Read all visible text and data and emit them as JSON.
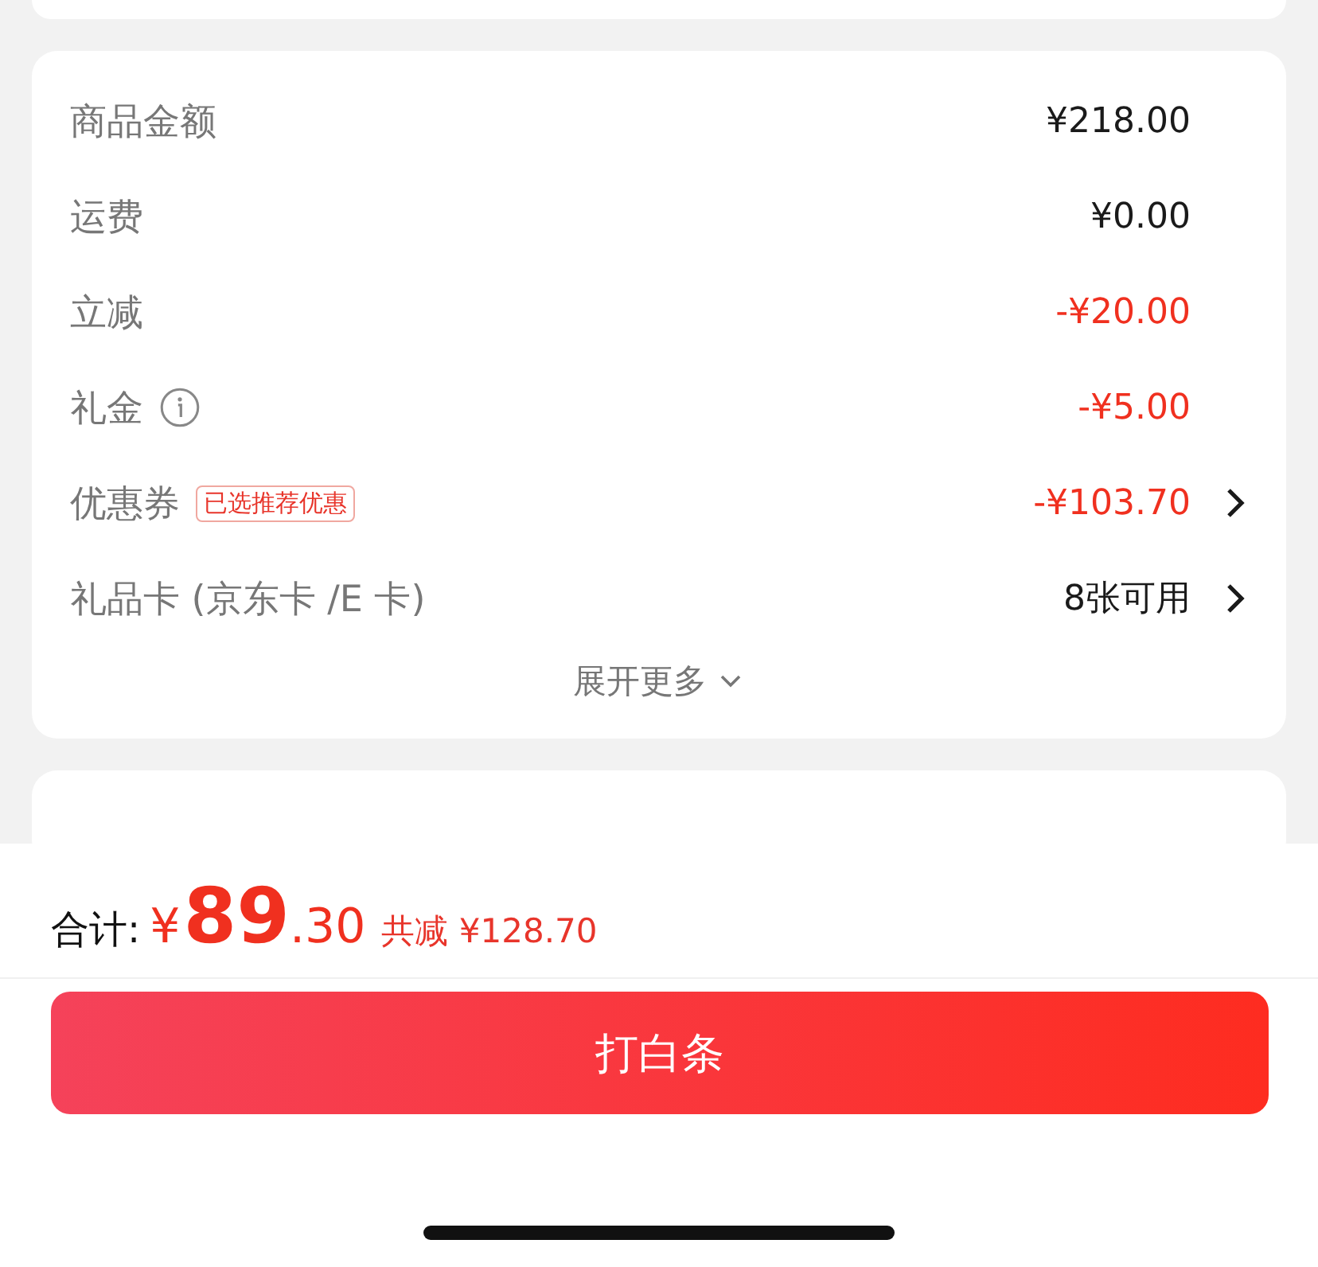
{
  "summary": {
    "rows": [
      {
        "label": "商品金额",
        "value": "¥218.00",
        "discount": false,
        "info": false,
        "arrow": false
      },
      {
        "label": "运费",
        "value": "¥0.00",
        "discount": false,
        "info": false,
        "arrow": false
      },
      {
        "label": "立减",
        "value": "-¥20.00",
        "discount": true,
        "info": false,
        "arrow": false
      },
      {
        "label": "礼金",
        "value": "-¥5.00",
        "discount": true,
        "info": true,
        "arrow": false
      },
      {
        "label": "优惠券",
        "tag": "已选推荐优惠",
        "value": "-¥103.70",
        "discount": true,
        "info": false,
        "arrow": true
      },
      {
        "label": "礼品卡 (京东卡 /E 卡)",
        "value": "8张可用",
        "discount": false,
        "info": false,
        "arrow": true
      }
    ],
    "expand": "展开更多"
  },
  "footer": {
    "total_label": "合计:",
    "currency": "¥",
    "integer": "89",
    "decimal": ".30",
    "saving": "共减 ¥128.70",
    "button": "打白条"
  }
}
